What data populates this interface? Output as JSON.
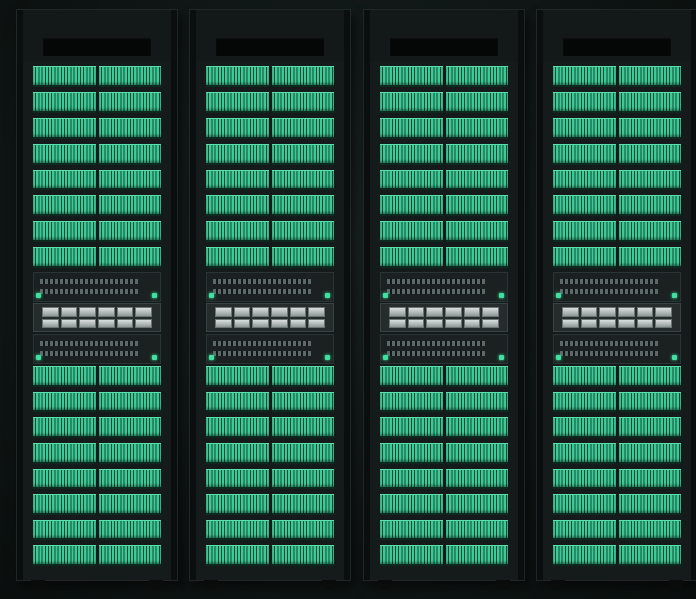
{
  "scene": {
    "description_free": true,
    "rack_count": 4,
    "colors": {
      "drive_accent": "#3fc996",
      "led_green": "#3fe0a2",
      "rack_body": "#151a1a",
      "background": "#101716"
    },
    "racks": [
      {
        "id": "rack-1",
        "upper_drive_shelves": 8,
        "lower_drive_shelves": 8,
        "switch_units": 2,
        "compute_node_modules": 12
      },
      {
        "id": "rack-2",
        "upper_drive_shelves": 8,
        "lower_drive_shelves": 8,
        "switch_units": 2,
        "compute_node_modules": 12
      },
      {
        "id": "rack-3",
        "upper_drive_shelves": 8,
        "lower_drive_shelves": 8,
        "switch_units": 2,
        "compute_node_modules": 12
      },
      {
        "id": "rack-4",
        "upper_drive_shelves": 8,
        "lower_drive_shelves": 8,
        "switch_units": 2,
        "compute_node_modules": 12
      }
    ]
  }
}
